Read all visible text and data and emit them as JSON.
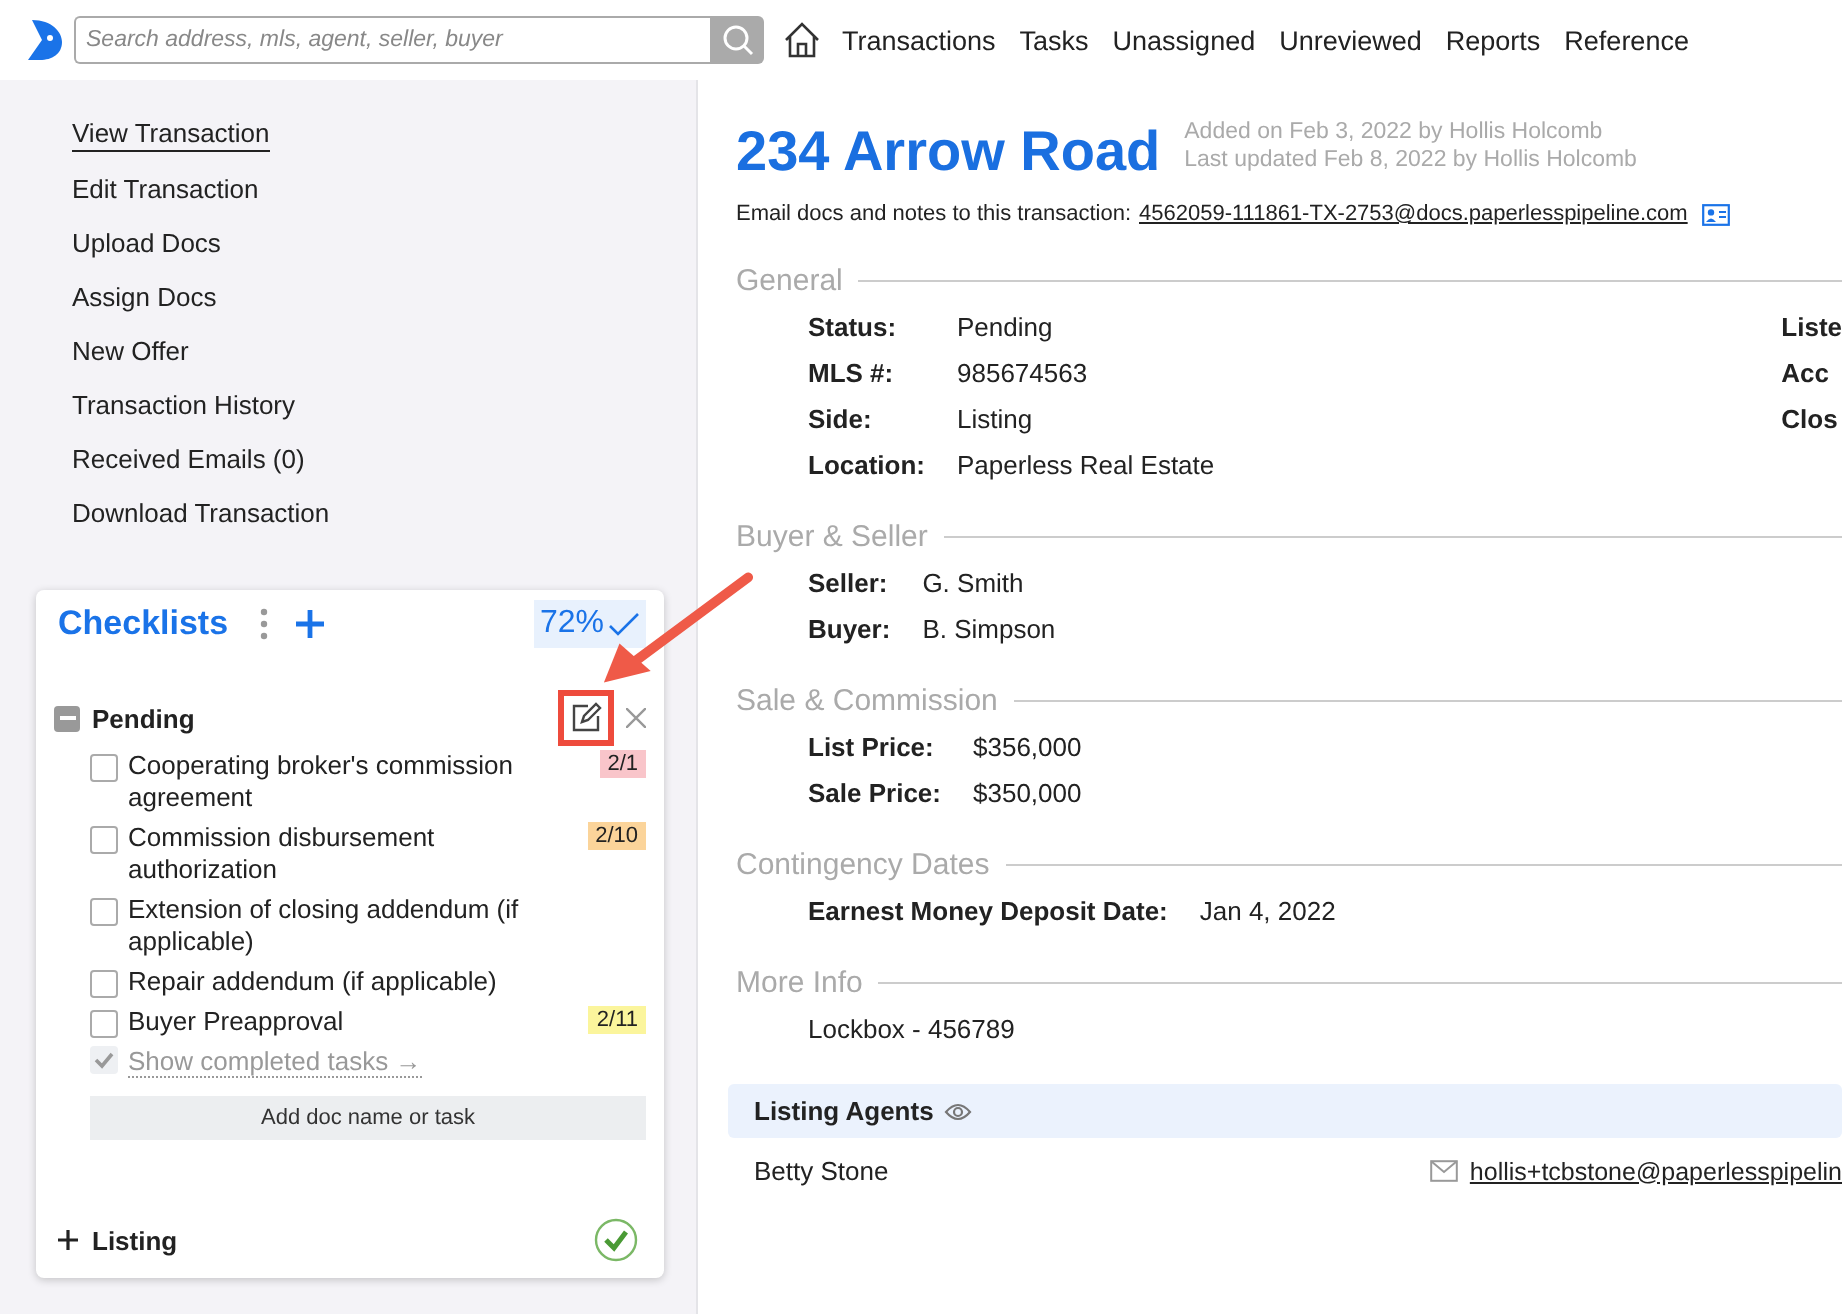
{
  "nav": {
    "search": {
      "placeholder": "Search address, mls, agent, seller, buyer"
    },
    "links": [
      {
        "label": "Transactions"
      },
      {
        "label": "Tasks"
      },
      {
        "label": "Unassigned"
      },
      {
        "label": "Unreviewed"
      },
      {
        "label": "Reports"
      },
      {
        "label": "Reference"
      }
    ]
  },
  "sidebar": {
    "items": [
      {
        "label": "View Transaction",
        "selected": true
      },
      {
        "label": "Edit Transaction",
        "selected": false
      },
      {
        "label": "Upload Docs",
        "selected": false
      },
      {
        "label": "Assign Docs",
        "selected": false
      },
      {
        "label": "New Offer",
        "selected": false
      },
      {
        "label": "Transaction History",
        "selected": false
      },
      {
        "label": "Received Emails (0)",
        "selected": false
      },
      {
        "label": "Download Transaction",
        "selected": false
      }
    ]
  },
  "checklists": {
    "title": "Checklists",
    "progress": "72%",
    "groups": [
      {
        "name": "Pending",
        "expanded": true,
        "complete": false,
        "tasks": [
          {
            "label": "Cooperating broker's commission agreement",
            "checked": false,
            "badge": "2/1",
            "color": "#f9c5ca"
          },
          {
            "label": "Commission disbursement authorization",
            "checked": false,
            "badge": "2/10",
            "color": "#fbd49a"
          },
          {
            "label": "Extension of closing addendum (if applicable)",
            "checked": false
          },
          {
            "label": "Repair addendum (if applicable)",
            "checked": false
          },
          {
            "label": "Buyer Preapproval",
            "checked": false,
            "badge": "2/11",
            "color": "#fbf59c"
          }
        ],
        "show_completed": "Show completed tasks →",
        "add_button": "Add doc name or task"
      },
      {
        "name": "Listing",
        "expanded": false,
        "complete": true
      }
    ]
  },
  "main": {
    "title": "234 Arrow Road",
    "added": "Added on Feb 3, 2022 by Hollis Holcomb",
    "updated": "Last updated Feb 8, 2022 by Hollis Holcomb",
    "email_label": "Email docs and notes to this transaction:",
    "email": "4562059-111861-TX-2753@docs.paperlesspipeline.com",
    "sections": [
      {
        "title": "General",
        "fields": [
          {
            "label": "Status:",
            "value": "Pending"
          },
          {
            "label": "MLS #:",
            "value": "985674563"
          },
          {
            "label": "Side:",
            "value": "Listing"
          },
          {
            "label": "Location:",
            "value": "Paperless Real Estate"
          }
        ],
        "side_labels": [
          "Liste",
          "Acc",
          "Clos"
        ]
      },
      {
        "title": "Buyer & Seller",
        "fields": [
          {
            "label": "Seller:",
            "value": "G. Smith"
          },
          {
            "label": "Buyer:",
            "value": "B. Simpson"
          }
        ]
      },
      {
        "title": "Sale & Commission",
        "fields": [
          {
            "label": "List Price:",
            "value": "$356,000"
          },
          {
            "label": "Sale Price:",
            "value": "$350,000"
          }
        ]
      },
      {
        "title": "Contingency Dates",
        "fields": [
          {
            "label": "Earnest Money Deposit Date:",
            "value": "Jan 4, 2022"
          }
        ]
      },
      {
        "title": "More Info",
        "notes": [
          "Lockbox - 456789"
        ]
      }
    ],
    "agents": {
      "title": "Listing Agents",
      "rows": [
        {
          "name": "Betty Stone",
          "email": "hollis+tcbstone@paperlesspipelin"
        }
      ]
    }
  }
}
